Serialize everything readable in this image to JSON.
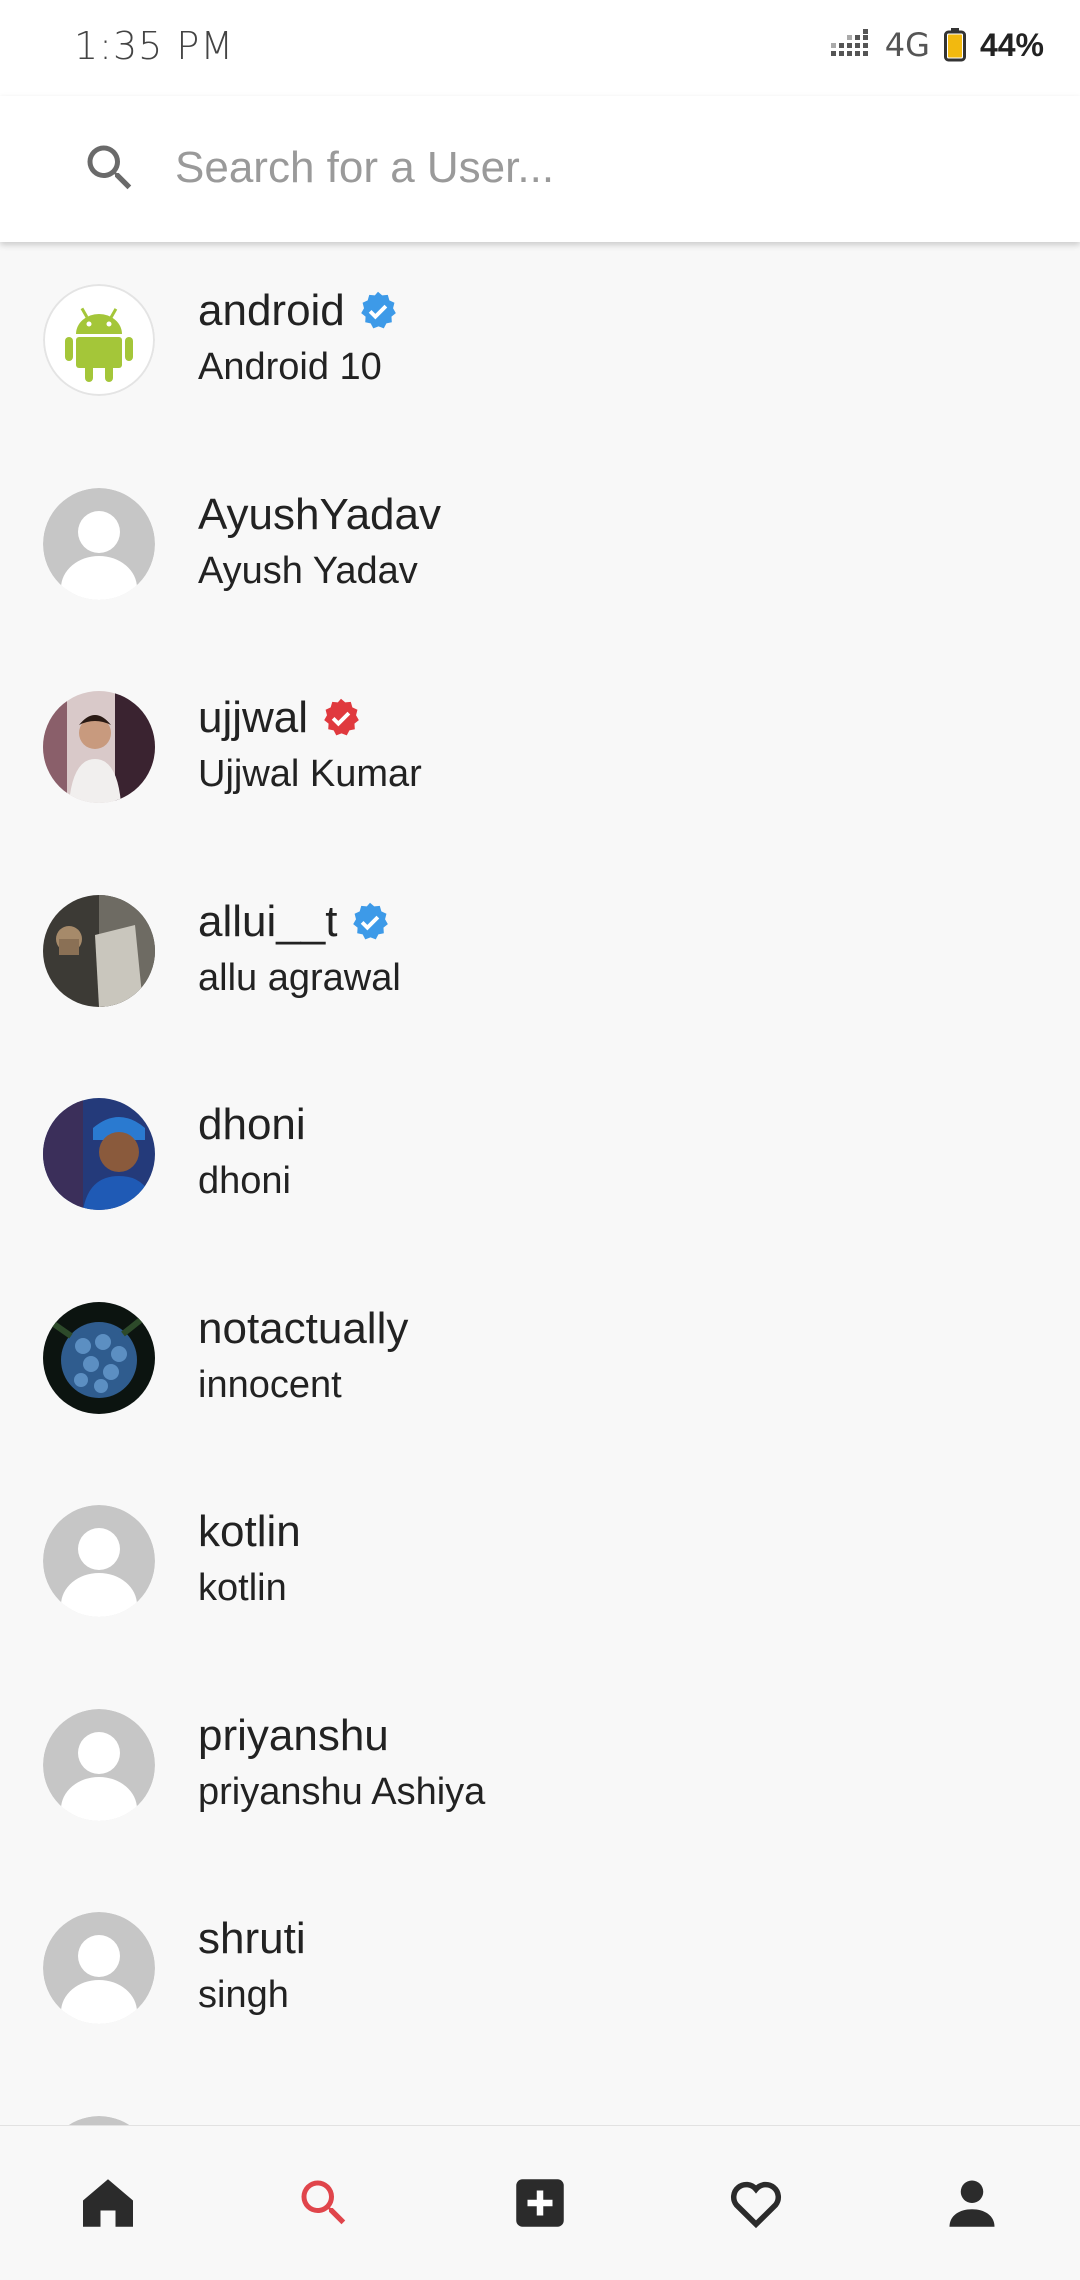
{
  "status_bar": {
    "time": "1:35 PM",
    "network": "4G",
    "battery_percent": "44%"
  },
  "search": {
    "placeholder": "Search for a User...",
    "value": ""
  },
  "users": [
    {
      "username": "android",
      "fullname": "Android 10",
      "avatar": "android-logo",
      "badge": "blue"
    },
    {
      "username": "AyushYadav",
      "fullname": "Ayush Yadav",
      "avatar": "default",
      "badge": ""
    },
    {
      "username": "ujjwal",
      "fullname": "Ujjwal Kumar",
      "avatar": "photo-person",
      "badge": "red"
    },
    {
      "username": "allui__t",
      "fullname": "allu agrawal",
      "avatar": "photo-dark",
      "badge": "blue"
    },
    {
      "username": "dhoni",
      "fullname": "dhoni",
      "avatar": "photo-cricketer",
      "badge": ""
    },
    {
      "username": "notactually",
      "fullname": "innocent",
      "avatar": "photo-flowers",
      "badge": ""
    },
    {
      "username": "kotlin",
      "fullname": "kotlin",
      "avatar": "default",
      "badge": ""
    },
    {
      "username": "priyanshu",
      "fullname": "priyanshu Ashiya",
      "avatar": "default",
      "badge": ""
    },
    {
      "username": "shruti",
      "fullname": "singh",
      "avatar": "default",
      "badge": ""
    }
  ],
  "bottom_nav": {
    "items": [
      {
        "icon": "home-icon",
        "active": false
      },
      {
        "icon": "search-icon",
        "active": true
      },
      {
        "icon": "add-post-icon",
        "active": false
      },
      {
        "icon": "heart-icon",
        "active": false
      },
      {
        "icon": "profile-icon",
        "active": false
      }
    ],
    "active_color": "#e0454b",
    "inactive_color": "#2b2b2b"
  },
  "colors": {
    "verified_blue": "#3d9ae8",
    "verified_red": "#e0393e",
    "android_green": "#a4c639"
  }
}
